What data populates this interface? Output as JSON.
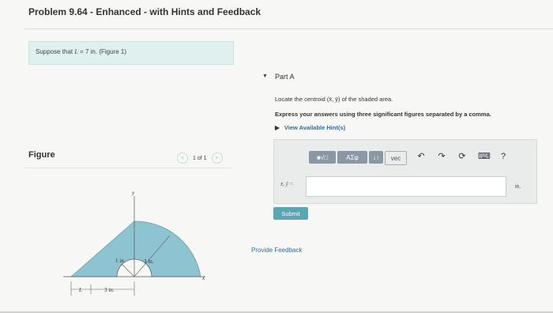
{
  "header": {
    "title": "Problem 9.64 - Enhanced - with Hints and Feedback"
  },
  "problem": {
    "prefix": "Suppose that",
    "var": "L",
    "eq": "= 7 in.",
    "figure_ref": "(Figure 1)"
  },
  "part": {
    "label": "Part A",
    "instruction": "Locate the centroid (x̄, ȳ) of the shaded area.",
    "express": "Express your answers using three significant figures separated by a comma.",
    "hints_label": "View Available Hint(s)"
  },
  "toolbar": {
    "sqrt_label": "■√□",
    "symbols_label": "ΑΣφ",
    "updown_label": "↓↑",
    "vec_label": "vec",
    "undo_icon": "undo-icon",
    "redo_icon": "redo-icon",
    "reset_icon": "reset-icon",
    "keyboard_icon": "keyboard-icon",
    "help_label": "?"
  },
  "answer": {
    "label": "x̄, ȳ =",
    "value": "",
    "unit": "in."
  },
  "buttons": {
    "submit": "Submit",
    "feedback": "Provide Feedback"
  },
  "figure": {
    "label": "Figure",
    "pager_text": "1 of 1",
    "prev": "<",
    "next": ">",
    "dim_1in": "1 in.",
    "dim_3in_top": "3 in.",
    "dim_L": "L",
    "dim_3in_bottom": "3 in.",
    "axis_x": "x",
    "axis_y": "y"
  },
  "colors": {
    "shaded": "#8ec3d1",
    "submit": "#5aa6b3",
    "link": "#2a6f9b"
  }
}
